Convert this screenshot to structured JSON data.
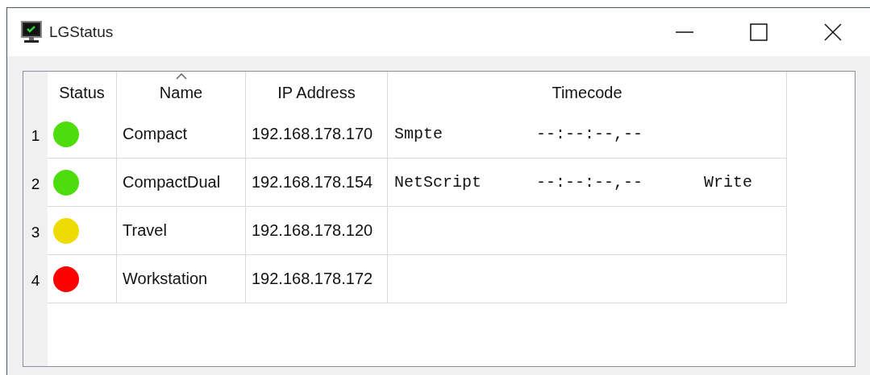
{
  "window": {
    "title": "LGStatus"
  },
  "table": {
    "columns": [
      {
        "label": "Status",
        "sorted": false
      },
      {
        "label": "Name",
        "sorted": true
      },
      {
        "label": "IP Address",
        "sorted": false
      },
      {
        "label": "Timecode",
        "sorted": false
      }
    ],
    "rows": [
      {
        "number": "1",
        "color": "#4ddd0c",
        "name": "Compact",
        "ip": "192.168.178.170",
        "timecode": {
          "source": "Smpte",
          "time": "--:--:--,--"
        }
      },
      {
        "number": "2",
        "color": "#4ddd0c",
        "name": "CompactDual",
        "ip": "192.168.178.154",
        "timecode": {
          "source": "NetScript",
          "time": "--:--:--,--",
          "mode": "Write"
        }
      },
      {
        "number": "3",
        "color": "#eedc00",
        "name": "Travel",
        "ip": "192.168.178.120"
      },
      {
        "number": "4",
        "color": "#ff0000",
        "name": "Workstation",
        "ip": "192.168.178.172"
      }
    ]
  }
}
